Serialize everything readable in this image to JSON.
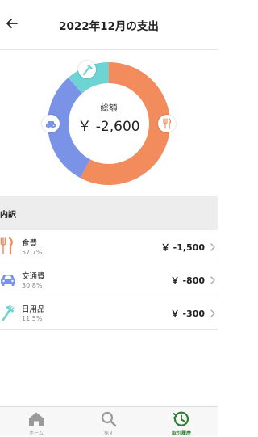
{
  "header": {
    "title": "2022年12月の支出",
    "back_icon": "arrow-left-icon"
  },
  "summary": {
    "total_label": "総額",
    "total_value": "￥ -2,600"
  },
  "chart_data": {
    "type": "pie",
    "variant": "donut",
    "categories": [
      "食費",
      "交通費",
      "日用品"
    ],
    "values": [
      -1500,
      -800,
      -300
    ],
    "percentages": [
      57.7,
      30.8,
      11.5
    ],
    "colors": [
      "#f28c5c",
      "#7b93e6",
      "#6ed3d3"
    ],
    "icons": [
      "fork-knife-icon",
      "car-icon",
      "toothbrush-icon"
    ],
    "title": "",
    "legend": "none"
  },
  "breakdown": {
    "title": "内訳",
    "items": [
      {
        "name": "食費",
        "percent": "57.7%",
        "amount": "￥ -1,500",
        "icon": "fork-knife-icon",
        "color": "#f28c5c"
      },
      {
        "name": "交通費",
        "percent": "30.8%",
        "amount": "￥ -800",
        "icon": "car-icon",
        "color": "#7b93e6"
      },
      {
        "name": "日用品",
        "percent": "11.5%",
        "amount": "￥ -300",
        "icon": "toothbrush-icon",
        "color": "#6ed3d3"
      }
    ]
  },
  "tabbar": {
    "tabs": [
      {
        "label": "ホーム",
        "icon": "home-icon",
        "active": false
      },
      {
        "label": "探す",
        "icon": "search-icon",
        "active": false
      },
      {
        "label": "取引履歴",
        "icon": "history-icon",
        "active": true
      }
    ],
    "active_color": "#2e7d32",
    "inactive_color": "#999999"
  }
}
